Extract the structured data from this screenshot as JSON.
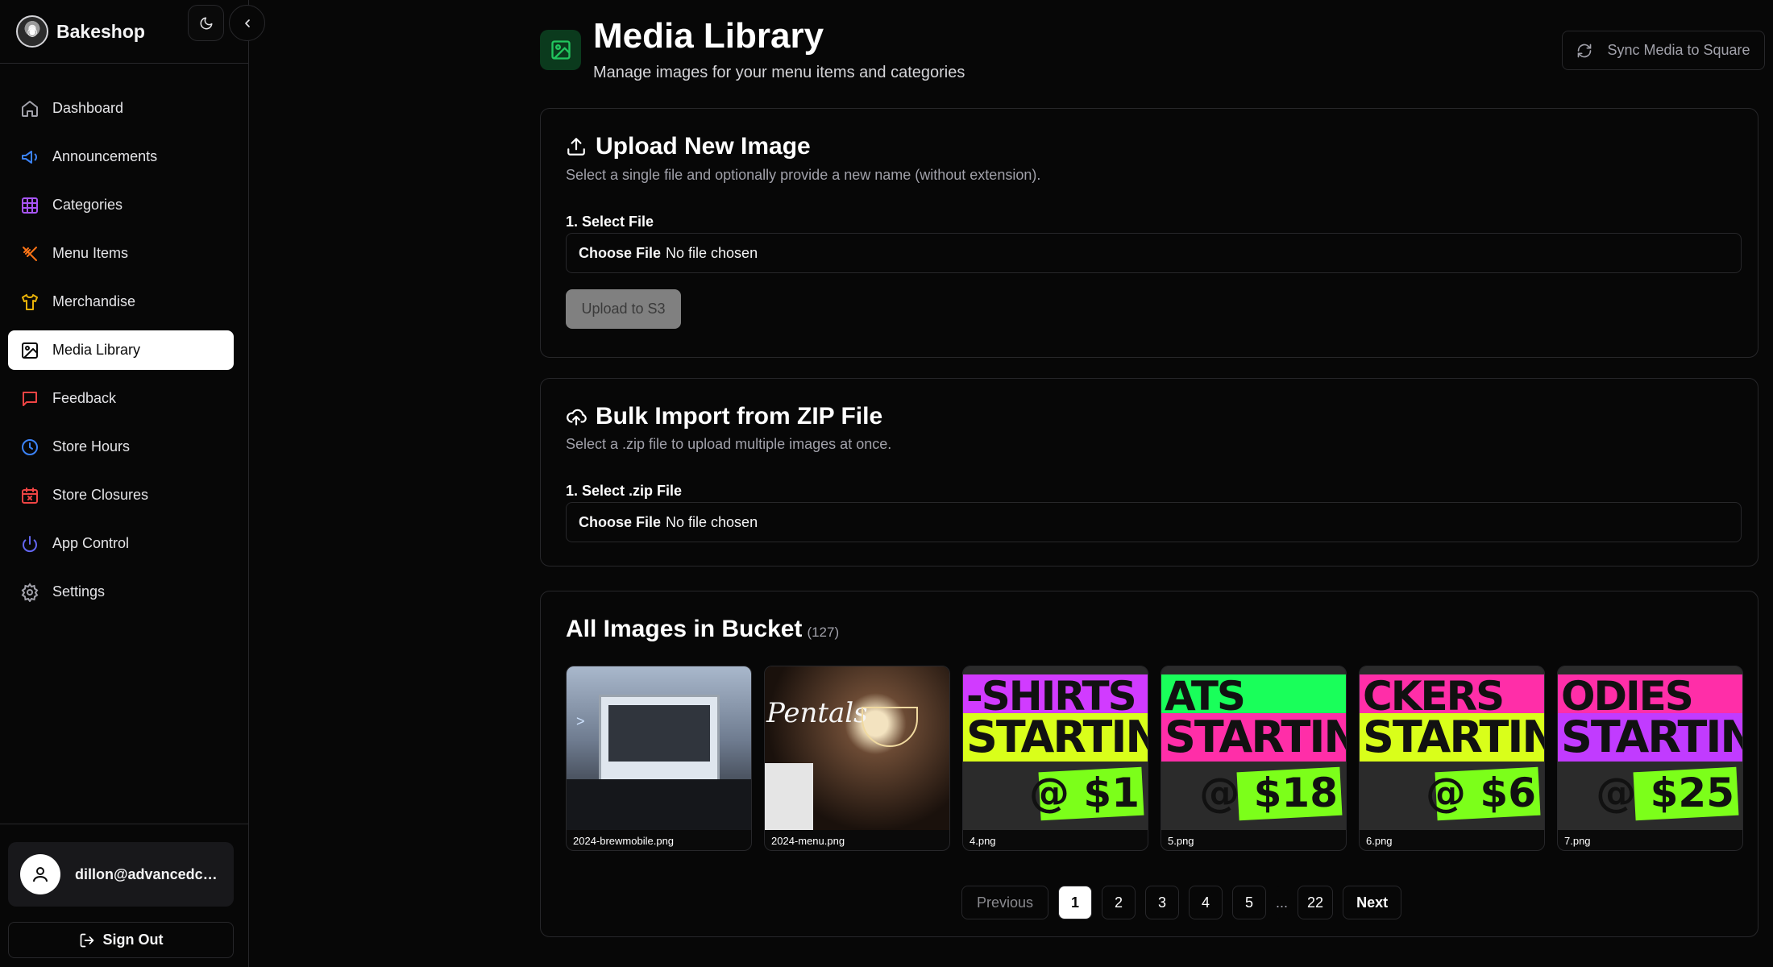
{
  "brand": {
    "name": "Bakeshop"
  },
  "sidebar": {
    "items": [
      {
        "label": "Dashboard",
        "icon": "home-icon"
      },
      {
        "label": "Announcements",
        "icon": "megaphone-icon"
      },
      {
        "label": "Categories",
        "icon": "grid-icon"
      },
      {
        "label": "Menu Items",
        "icon": "utensils-icon"
      },
      {
        "label": "Merchandise",
        "icon": "shirt-icon"
      },
      {
        "label": "Media Library",
        "icon": "image-icon",
        "active": true
      },
      {
        "label": "Feedback",
        "icon": "message-icon"
      },
      {
        "label": "Store Hours",
        "icon": "clock-icon"
      },
      {
        "label": "Store Closures",
        "icon": "calendar-x-icon"
      },
      {
        "label": "App Control",
        "icon": "power-icon"
      },
      {
        "label": "Settings",
        "icon": "gear-icon"
      }
    ],
    "user_email": "dillon@advancedcsll...",
    "sign_out_label": "Sign Out"
  },
  "header": {
    "title": "Media Library",
    "subtitle": "Manage images for your menu items and categories",
    "sync_label": "Sync Media to Square"
  },
  "upload": {
    "title": "Upload New Image",
    "description": "Select a single file and optionally provide a new name (without extension).",
    "field_label": "1. Select File",
    "choose_label": "Choose File",
    "no_file": "No file chosen",
    "button_label": "Upload to S3"
  },
  "bulk": {
    "title": "Bulk Import from ZIP File",
    "description": "Select a .zip file to upload multiple images at once.",
    "field_label": "1. Select .zip File",
    "choose_label": "Choose File",
    "no_file": "No file chosen"
  },
  "gallery": {
    "title": "All Images in Bucket",
    "count": "(127)",
    "images": [
      {
        "name": "2024-brewmobile.png"
      },
      {
        "name": "2024-menu.png",
        "art": "Pentals"
      },
      {
        "name": "4.png",
        "art_top": "-SHIRTS",
        "art_mid": "STARTING",
        "art_price": "@ $1"
      },
      {
        "name": "5.png",
        "art_top": "ATS",
        "art_mid": "STARTING",
        "art_price": "@ $18"
      },
      {
        "name": "6.png",
        "art_top": "CKERS",
        "art_mid": "STARTING",
        "art_price": "@ $6"
      },
      {
        "name": "7.png",
        "art_top": "ODIES",
        "art_mid": "STARTING",
        "art_price": "@ $25"
      }
    ]
  },
  "pagination": {
    "previous": "Previous",
    "pages": [
      "1",
      "2",
      "3",
      "4",
      "5"
    ],
    "current": "1",
    "ellipsis": "...",
    "last": "22",
    "next": "Next"
  },
  "colors": {
    "accent_green": "#22c55e",
    "background": "#070707",
    "border": "#27272a"
  }
}
